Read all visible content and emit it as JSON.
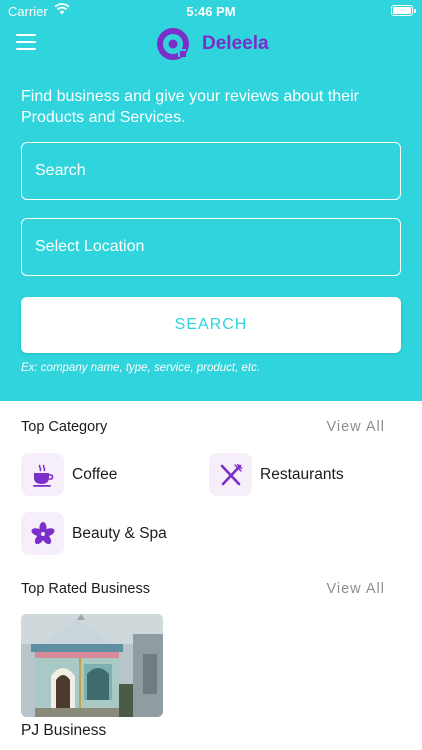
{
  "status_bar": {
    "carrier": "Carrier",
    "time": "5:46 PM"
  },
  "navbar": {
    "app_name": "Deleela",
    "logo_color": "#7b2fc8"
  },
  "hero": {
    "background": "#2fd4dc",
    "tagline": "Find business and give your reviews about their Products and Services.",
    "search_placeholder": "Search",
    "location_placeholder": "Select Location",
    "search_button": "SEARCH",
    "hint": "Ex: company name, type, service, product, etc."
  },
  "top_category": {
    "title": "Top Category",
    "view_all": "View All",
    "items": [
      {
        "label": "Coffee",
        "icon": "coffee-cup-icon"
      },
      {
        "label": "Restaurants",
        "icon": "fork-knife-icon"
      },
      {
        "label": "Beauty & Spa",
        "icon": "flower-icon"
      }
    ]
  },
  "top_rated": {
    "title": "Top Rated Business",
    "view_all": "View All",
    "items": [
      {
        "name": "PJ Business"
      }
    ]
  }
}
